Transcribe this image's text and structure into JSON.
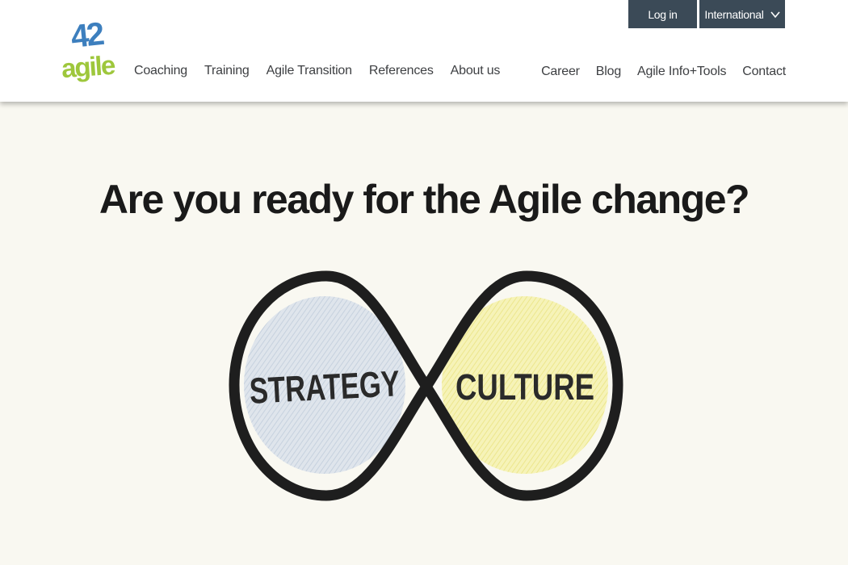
{
  "logo": {
    "number": "42",
    "word": "agile"
  },
  "header": {
    "nav_left": [
      "Coaching",
      "Training",
      "Agile Transition",
      "References",
      "About us"
    ],
    "nav_right": [
      "Career",
      "Blog",
      "Agile Info+Tools",
      "Contact"
    ],
    "login_label": "Log in",
    "international_label": "International"
  },
  "hero": {
    "title": "Are you ready for the Agile change?",
    "left_label": "STRATEGY",
    "right_label": "CULTURE"
  },
  "colors": {
    "header_button_bg": "#3b4a57",
    "logo_blue": "#3d7fbe",
    "logo_green": "#9ec73c",
    "page_bg": "#f9f8f1",
    "strategy_fill": "#d4dde8",
    "culture_fill": "#f4f0a6"
  }
}
